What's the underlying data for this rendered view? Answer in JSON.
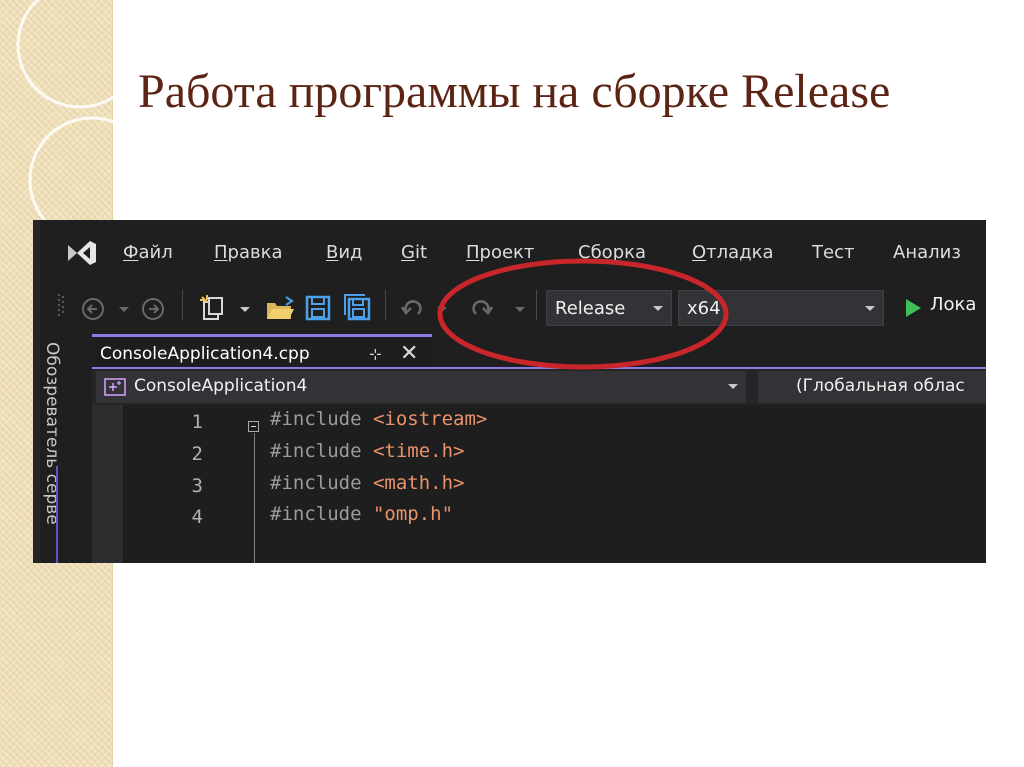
{
  "slide": {
    "title": "Работа программы на сборке Release"
  },
  "ide": {
    "menu": [
      {
        "label": "Файл",
        "access": "Ф",
        "rest": "айл"
      },
      {
        "label": "Правка",
        "access": "П",
        "rest": "равка"
      },
      {
        "label": "Вид",
        "access": "В",
        "rest": "ид"
      },
      {
        "label": "Git",
        "access": "G",
        "rest": "it"
      },
      {
        "label": "Проект",
        "access": "П",
        "rest": "роект"
      },
      {
        "label": "Сборка",
        "access": "С",
        "rest": "борка"
      },
      {
        "label": "Отладка",
        "access": "О",
        "rest": "тладка"
      },
      {
        "label": "Тест",
        "access": "Тест",
        "rest": ""
      },
      {
        "label": "Анализ",
        "access": "Анализ",
        "rest": ""
      }
    ],
    "toolbar": {
      "configuration": "Release",
      "platform": "x64",
      "run_label": "Лока"
    },
    "tab": {
      "filename": "ConsoleApplication4.cpp",
      "pin": "⊹",
      "close": "✕"
    },
    "side_panel": {
      "label": "Обозреватель серве"
    },
    "navbar": {
      "project": "ConsoleApplication4",
      "scope": "(Глобальная облас"
    },
    "code": {
      "lines": [
        {
          "num": "1",
          "directive": "#include ",
          "arg": "<iostream>"
        },
        {
          "num": "2",
          "directive": "#include ",
          "arg": "<time.h>"
        },
        {
          "num": "3",
          "directive": "#include ",
          "arg": "<math.h>"
        },
        {
          "num": "4",
          "directive": "#include ",
          "arg": "\"omp.h\""
        }
      ]
    }
  },
  "annotation": {
    "color": "#c8262a"
  }
}
